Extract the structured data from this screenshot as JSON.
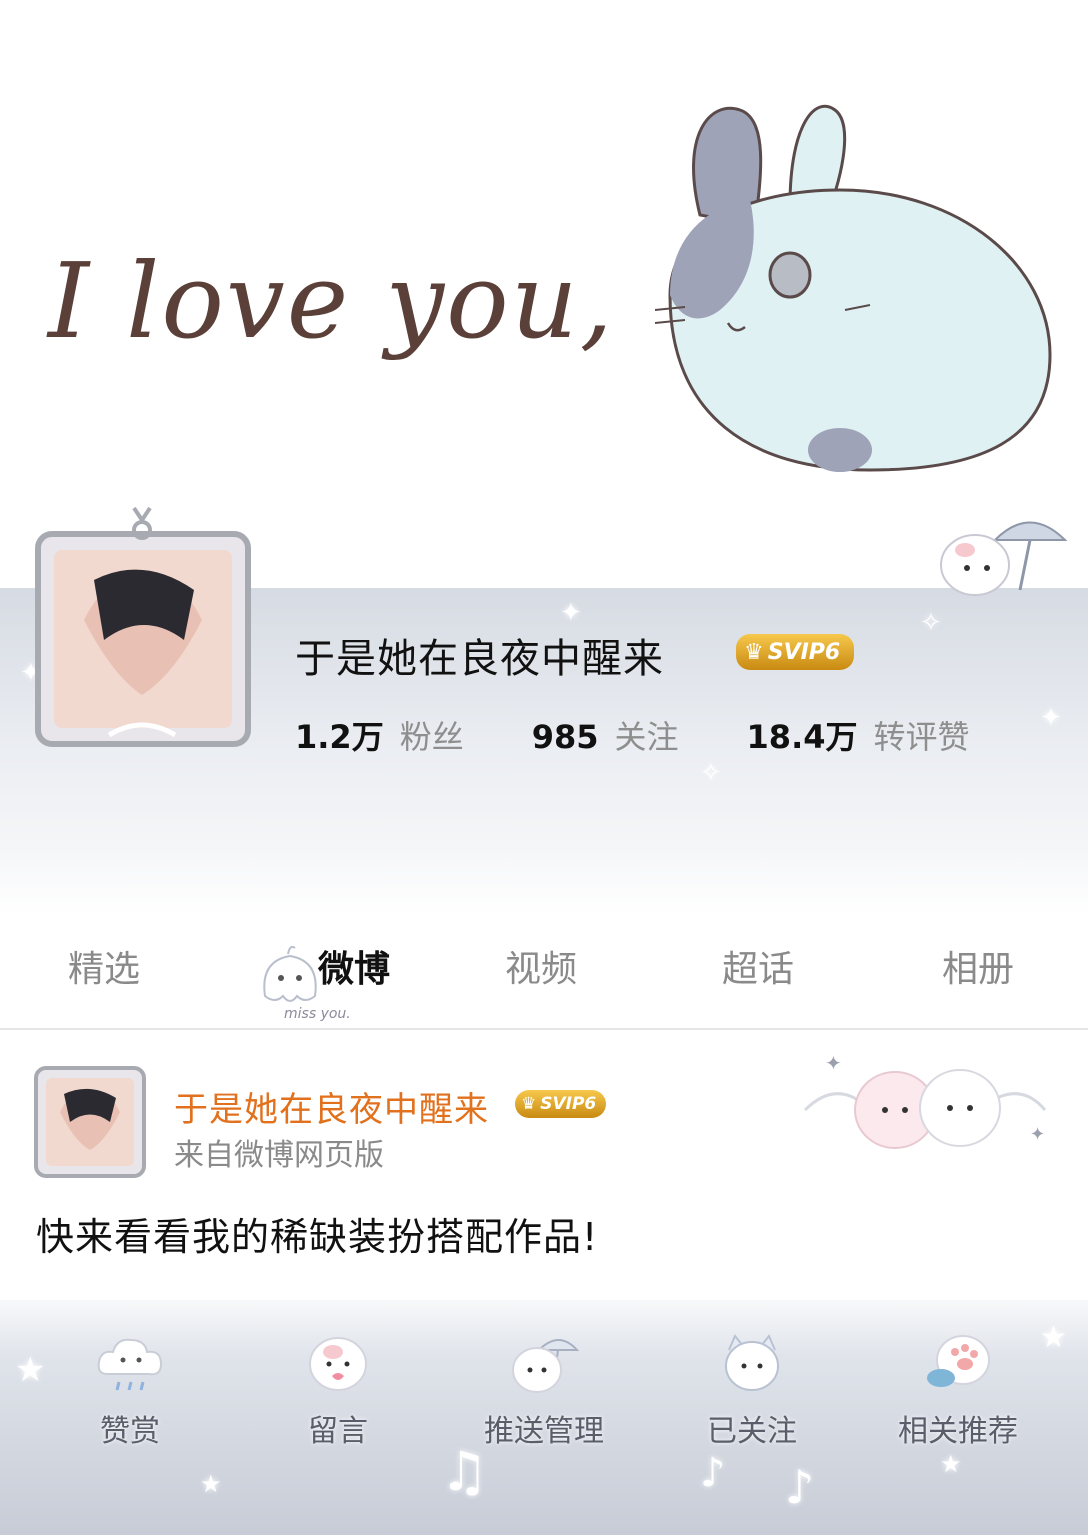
{
  "banner": {
    "text": "I love you,",
    "illustration": "bunny-illustration"
  },
  "profile": {
    "name": "于是她在良夜中醒来",
    "vip_badge": "SVIP6",
    "stats": [
      {
        "value": "1.2万",
        "label": "粉丝"
      },
      {
        "value": "985",
        "label": "关注"
      },
      {
        "value": "18.4万",
        "label": "转评赞"
      }
    ]
  },
  "tabs": [
    {
      "label": "精选"
    },
    {
      "label": "微博"
    },
    {
      "label": "视频"
    },
    {
      "label": "超话"
    },
    {
      "label": "相册"
    }
  ],
  "tab_decoration_text": "miss you.",
  "post": {
    "author": "于是她在良夜中醒来",
    "vip_badge": "SVIP6",
    "source": "来自微博网页版",
    "text": "快来看看我的稀缺装扮搭配作品!"
  },
  "actions": [
    {
      "label": "赞赏",
      "icon": "cloud-icon"
    },
    {
      "label": "留言",
      "icon": "kitten-heart-icon"
    },
    {
      "label": "推送管理",
      "icon": "kitten-umbrella-icon"
    },
    {
      "label": "已关注",
      "icon": "kitten-icon"
    },
    {
      "label": "相关推荐",
      "icon": "paw-icon"
    }
  ],
  "colors": {
    "accent_name": "#e2711d",
    "vip_gold": "#f0b429",
    "banner_text": "#5a4038"
  }
}
